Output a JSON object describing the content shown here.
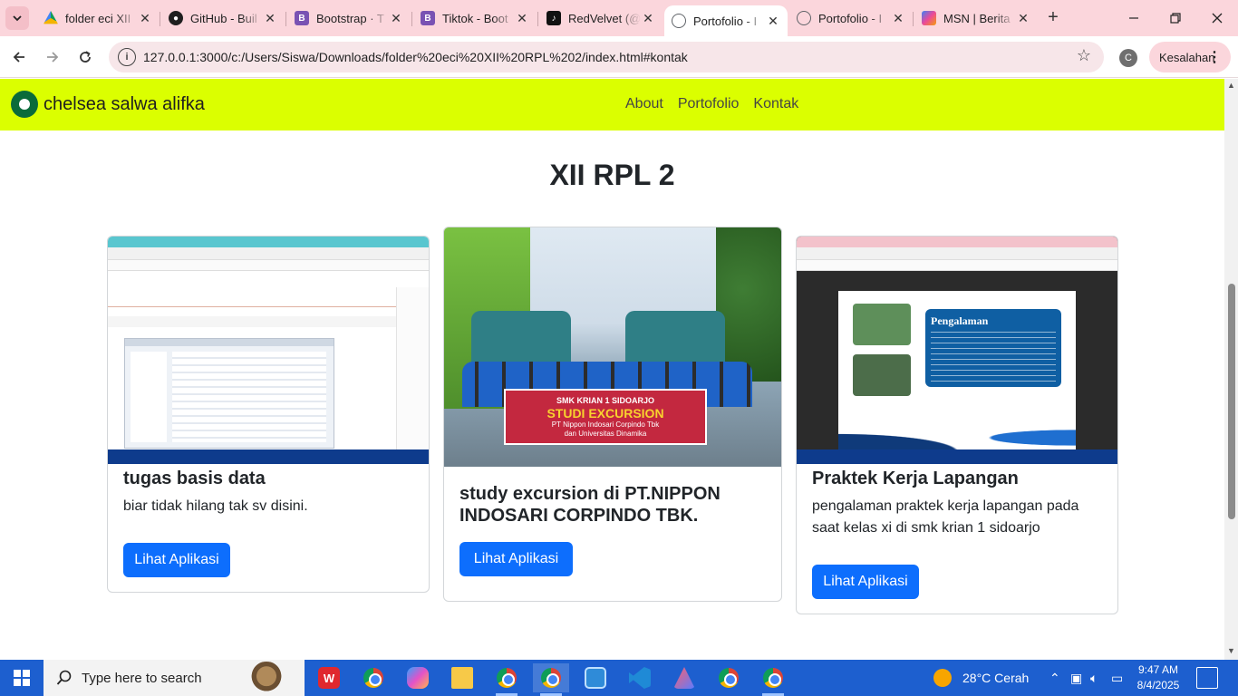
{
  "browser": {
    "tabs": [
      {
        "title": "folder eci XII",
        "favicon": "google-drive-icon",
        "color": "#1a73e8"
      },
      {
        "title": "GitHub - Buil",
        "favicon": "github-icon",
        "color": "#1f1f1f"
      },
      {
        "title": "Bootstrap · T",
        "favicon": "bootstrap-icon",
        "color": "#7952b3"
      },
      {
        "title": "Tiktok - Boot",
        "favicon": "bootstrap-icon",
        "color": "#7952b3"
      },
      {
        "title": "RedVelvet (@",
        "favicon": "tiktok-icon",
        "color": "#111111"
      },
      {
        "title": "Portofolio - I",
        "favicon": "globe-icon",
        "color": "#5f6368",
        "active": true
      },
      {
        "title": "Portofolio - I",
        "favicon": "globe-icon",
        "color": "#5f6368"
      },
      {
        "title": "MSN | Berita",
        "favicon": "msn-icon",
        "color": "#8e44ad"
      }
    ],
    "url": "127.0.0.1:3000/c:/Users/Siswa/Downloads/folder%20eci%20XII%20RPL%202/index.html#kontak",
    "profile_initial": "C",
    "error_label": "Kesalahan"
  },
  "site": {
    "brand": "chelsea salwa alifka",
    "nav": [
      "About",
      "Portofolio",
      "Kontak"
    ],
    "section_title": "XII RPL 2",
    "cards": [
      {
        "title": "tugas basis data",
        "text": "biar tidak hilang tak sv disini.",
        "button": "Lihat Aplikasi"
      },
      {
        "title": "study excursion di PT.NIPPON INDOSARI CORPINDO TBK.",
        "text": "",
        "button": "Lihat Aplikasi",
        "banner_lines": [
          "SMK KRIAN 1 SIDOARJO",
          "STUDI EXCURSION",
          "PT Nippon Indosari Corpindo Tbk",
          "dan Universitas Dinamika"
        ]
      },
      {
        "title": "Praktek Kerja Lapangan",
        "text": "pengalaman praktek kerja lapangan pada saat kelas xi di smk krian 1 sidoarjo",
        "button": "Lihat Aplikasi",
        "slide_heading": "Pengalaman"
      }
    ],
    "accent_color": "#dbff00",
    "button_color": "#0d6efd"
  },
  "taskbar": {
    "search_placeholder": "Type here to search",
    "weather": "28°C  Cerah",
    "time": "9:47 AM",
    "date": "8/4/2025"
  }
}
